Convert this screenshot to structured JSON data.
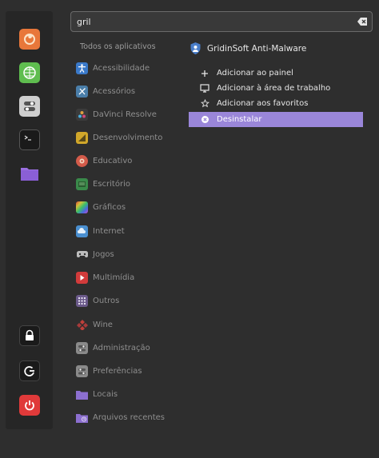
{
  "search": {
    "value": "gril"
  },
  "favorites": [
    {
      "name": "firefox-icon",
      "color": "#e8773a"
    },
    {
      "name": "green-app-icon",
      "color": "#5fbd4f"
    },
    {
      "name": "settings-toggle-icon",
      "color": "#cfcfcf"
    },
    {
      "name": "terminal-icon",
      "color": "#1e1e1e"
    },
    {
      "name": "folder-icon",
      "color": "#9a6fe0"
    },
    {
      "name": "lock-icon",
      "color": "#1e1e1e"
    },
    {
      "name": "logout-icon",
      "color": "#1e1e1e"
    },
    {
      "name": "power-icon",
      "color": "#e03a3a"
    }
  ],
  "categories": {
    "header": "Todos os aplicativos",
    "items": [
      {
        "label": "Acessibilidade",
        "icon": "accessibility-icon",
        "color": "#3a79c9"
      },
      {
        "label": "Acessórios",
        "icon": "accessories-icon",
        "color": "#4a7ea9"
      },
      {
        "label": "DaVinci Resolve",
        "icon": "davinci-icon",
        "color": "#3b3b3b"
      },
      {
        "label": "Desenvolvimento",
        "icon": "development-icon",
        "color": "#d1a72a"
      },
      {
        "label": "Educativo",
        "icon": "education-icon",
        "color": "#d35b4a"
      },
      {
        "label": "Escritório",
        "icon": "office-icon",
        "color": "#3a8a4a"
      },
      {
        "label": "Gráficos",
        "icon": "graphics-icon",
        "color": "#c04fd0"
      },
      {
        "label": "Internet",
        "icon": "internet-icon",
        "color": "#4a8fd0"
      },
      {
        "label": "Jogos",
        "icon": "games-icon",
        "color": "#3a3a3a"
      },
      {
        "label": "Multimídia",
        "icon": "multimedia-icon",
        "color": "#d23b3b"
      },
      {
        "label": "Outros",
        "icon": "others-icon",
        "color": "#6b5a8a"
      },
      {
        "label": "Wine",
        "icon": "wine-icon",
        "color": "#a83a3a"
      },
      {
        "label": "Administração",
        "icon": "administration-icon",
        "color": "#8a8a8a"
      },
      {
        "label": "Preferências",
        "icon": "preferences-icon",
        "color": "#8a8a8a"
      },
      {
        "label": "Locais",
        "icon": "places-icon",
        "color": "#8c6fd0"
      },
      {
        "label": "Arquivos recentes",
        "icon": "recent-files-icon",
        "color": "#8c6fd0"
      }
    ]
  },
  "app": {
    "title": "GridinSoft Anti-Malware",
    "actions": [
      {
        "label": "Adicionar ao painel",
        "icon": "plus-icon"
      },
      {
        "label": "Adicionar à área de trabalho",
        "icon": "desktop-icon"
      },
      {
        "label": "Adicionar aos favoritos",
        "icon": "star-icon"
      },
      {
        "label": "Desinstalar",
        "icon": "uninstall-icon",
        "selected": true
      }
    ]
  },
  "colors": {
    "accent": "#9a86d9",
    "background": "#2e2e2e",
    "sidebar": "#262626"
  }
}
